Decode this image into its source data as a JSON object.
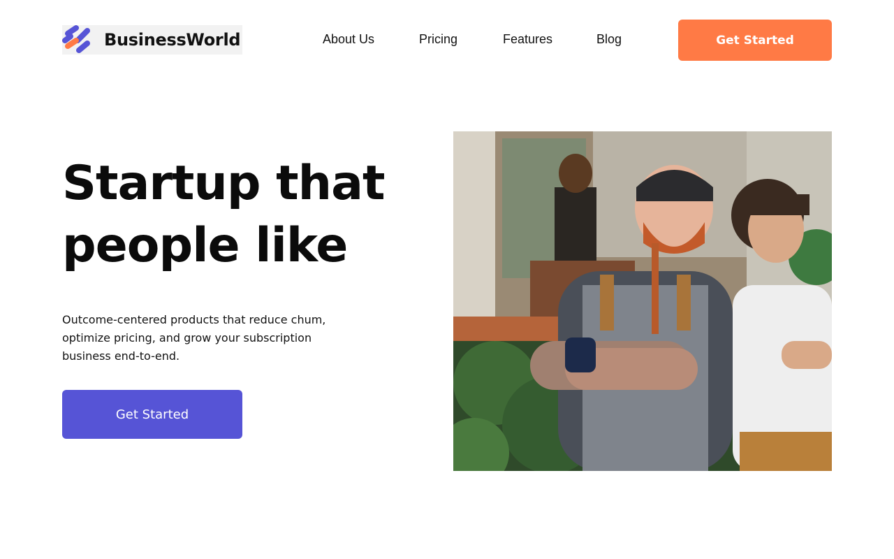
{
  "brand": {
    "name": "BusinessWorld",
    "logo_colors": {
      "primary": "#5654d6",
      "accent": "#ff7a45"
    }
  },
  "nav": {
    "items": [
      {
        "label": "About Us"
      },
      {
        "label": "Pricing"
      },
      {
        "label": "Features"
      },
      {
        "label": "Blog"
      }
    ],
    "cta_label": "Get Started"
  },
  "hero": {
    "title": "Startup that people like",
    "description": "Outcome-centered products that reduce chum, optimize pricing, and grow your subscription business end-to-end.",
    "cta_label": "Get Started",
    "image_icon": "photo-two-baristas"
  },
  "colors": {
    "cta_orange": "#ff7a45",
    "cta_purple": "#5654d6",
    "text": "#111111",
    "background": "#ffffff"
  }
}
